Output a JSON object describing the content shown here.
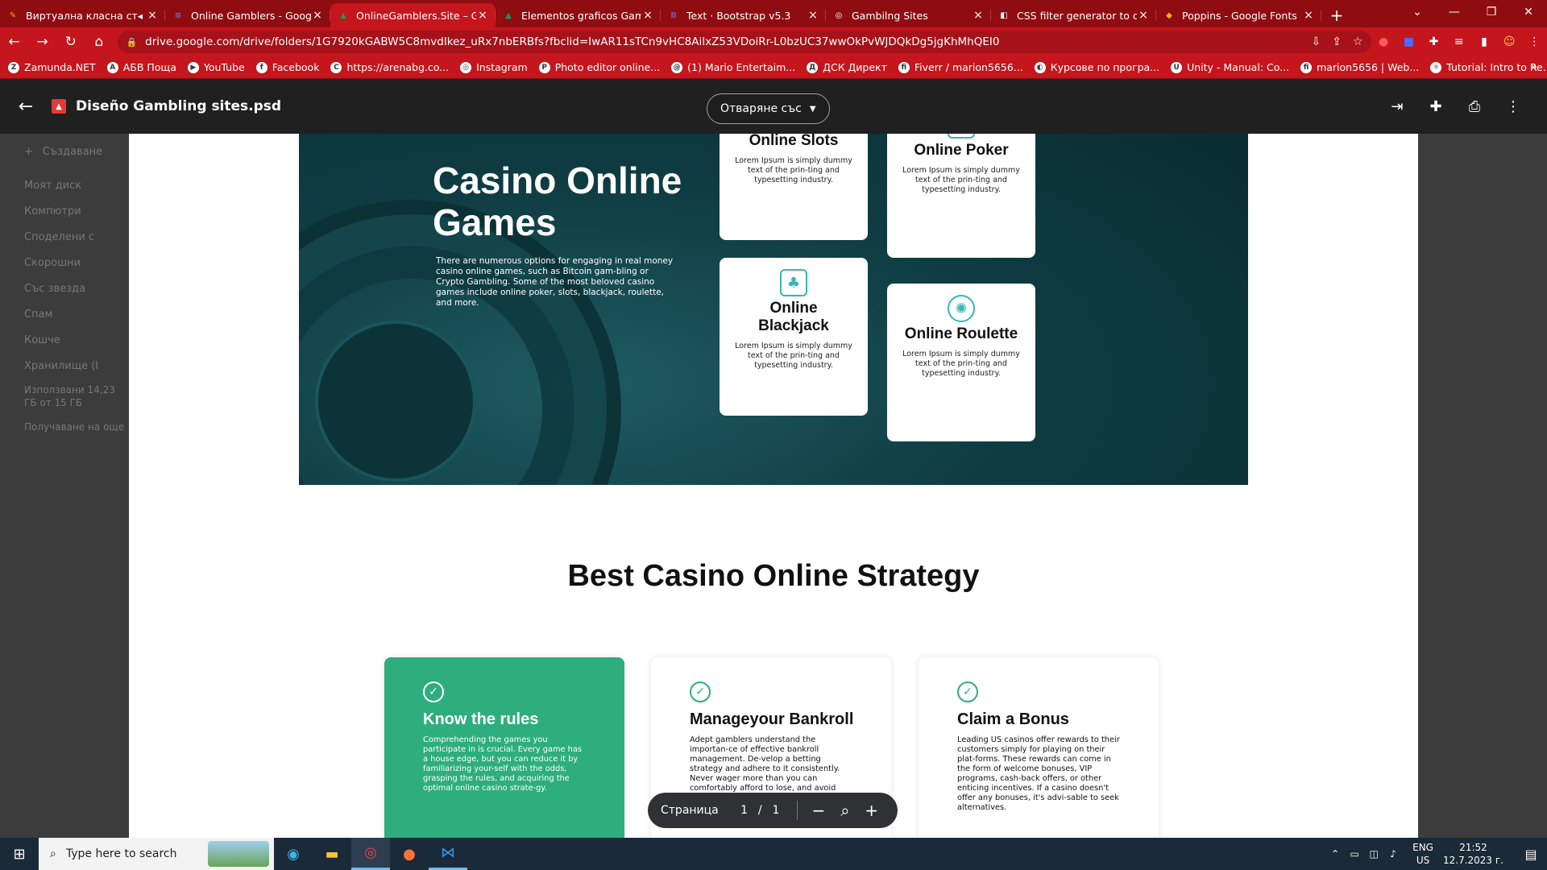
{
  "browser": {
    "tabs": [
      {
        "title": "Виртуална класна ста",
        "fav": "✎",
        "color": "#f6a623",
        "active": false,
        "mute": true
      },
      {
        "title": "Online Gamblers - Google",
        "fav": "≡",
        "color": "#4285f4",
        "active": false
      },
      {
        "title": "OnlineGamblers.Site – Goc",
        "fav": "▲",
        "color": "#0f9d58",
        "active": true
      },
      {
        "title": "Elementos graficos Gambl",
        "fav": "▲",
        "color": "#0f9d58",
        "active": false
      },
      {
        "title": "Text · Bootstrap v5.3",
        "fav": "B",
        "color": "#7952b3",
        "active": false
      },
      {
        "title": "Gambilng Sites",
        "fav": "◎",
        "color": "#ffffff",
        "active": false
      },
      {
        "title": "CSS filter generator to con",
        "fav": "◧",
        "color": "#ffffff",
        "active": false
      },
      {
        "title": "Poppins - Google Fonts",
        "fav": "◆",
        "color": "#fbbc05",
        "active": false
      }
    ],
    "url": "drive.google.com/drive/folders/1G7920kGABW5C8mvdIkez_uRx7nbERBfs?fbclid=IwAR11sTCn9vHC8AiIxZ53VDoiRr-L0bzUC37wwOkPvWJDQkDg5jgKhMhQEI0",
    "bookmarks": [
      {
        "label": "Zamunda.NET",
        "ic": "Z"
      },
      {
        "label": "АБВ Поща",
        "ic": "A"
      },
      {
        "label": "YouTube",
        "ic": "▶"
      },
      {
        "label": "Facebook",
        "ic": "f"
      },
      {
        "label": "https://arenabg.co...",
        "ic": "C"
      },
      {
        "label": "Instagram",
        "ic": "◎"
      },
      {
        "label": "Photo editor online...",
        "ic": "P"
      },
      {
        "label": "(1) Mario Entertaim...",
        "ic": "@"
      },
      {
        "label": "ДСК Директ",
        "ic": "Д"
      },
      {
        "label": "Fiverr / marion5656...",
        "ic": "fi"
      },
      {
        "label": "Курсове по програ...",
        "ic": "◐"
      },
      {
        "label": "Unity - Manual: Co...",
        "ic": "U"
      },
      {
        "label": "marion5656 | Web...",
        "ic": "fi"
      },
      {
        "label": "Tutorial: Intro to Re...",
        "ic": "⚛"
      }
    ]
  },
  "drive_bg": {
    "create": "Създаване",
    "items": [
      "Моят диск",
      "Компютри",
      "Споделени с",
      "Скорошни",
      "Със звезда",
      "Спам",
      "Кошче",
      "Хранилище (I"
    ],
    "usage": "Използвани 14,23 ГБ от 15 ГБ",
    "get_more": "Получаване на още"
  },
  "preview": {
    "file_name": "Diseño Gambling sites.psd",
    "open_with": "Отваряне със",
    "page_label": "Страница",
    "page_current": "1",
    "page_sep": "/",
    "page_total": "1"
  },
  "hero": {
    "title": "Casino Online Games",
    "text": "There are numerous options for engaging in real money casino online games, such as Bitcoin gam-bling or Crypto Gambling. Some of the most beloved casino games include online poker, slots, blackjack, roulette, and more.",
    "cards": [
      {
        "title": "Online Slots",
        "text": "Lorem Ipsum is simply dummy text of the prin-ting and typesetting industry.",
        "icon": "▣"
      },
      {
        "title": "Online Poker",
        "text": "Lorem Ipsum is simply dummy text of the prin-ting and typesetting industry.",
        "icon": "♠"
      },
      {
        "title": "Online Blackjack",
        "text": "Lorem Ipsum is simply dummy text of the prin-ting and typesetting industry.",
        "icon": "♣"
      },
      {
        "title": "Online Roulette",
        "text": "Lorem Ipsum is simply dummy text of the prin-ting and typesetting industry.",
        "icon": "✺"
      }
    ]
  },
  "strategy": {
    "title": "Best Casino Online Strategy",
    "cards": [
      {
        "title": "Know the rules",
        "text": "Comprehending the games you participate in is crucial. Every game has a house edge, but you can reduce it by familiarizing your-self with the odds, grasping the rules, and acquiring the optimal online casino strate-gy."
      },
      {
        "title": "Manageyour Bankroll",
        "text": "Adept gamblers understand the importan-ce of effective bankroll management. De-velop a betting strategy and adhere to it consistently. Never wager more than you can comfortably afford to lose, and avoid chasing losses as well."
      },
      {
        "title": "Claim a Bonus",
        "text": "Leading US casinos offer rewards to their customers simply for playing on their plat-forms. These rewards can come in the form of welcome bonuses, VIP programs, cash-back offers, or other enticing incentives. If a casino doesn't offer any bonuses, it's advi-sable to seek alternatives."
      }
    ]
  },
  "taskbar": {
    "search_placeholder": "Type here to search",
    "lang": "ENG",
    "region": "US",
    "time": "21:52",
    "date": "12.7.2023 г."
  },
  "colors": {
    "chrome_red": "#c4161c",
    "hero_teal": "#0f3d43",
    "accent_green": "#2eae7c",
    "icon_teal": "#37b6b3"
  }
}
